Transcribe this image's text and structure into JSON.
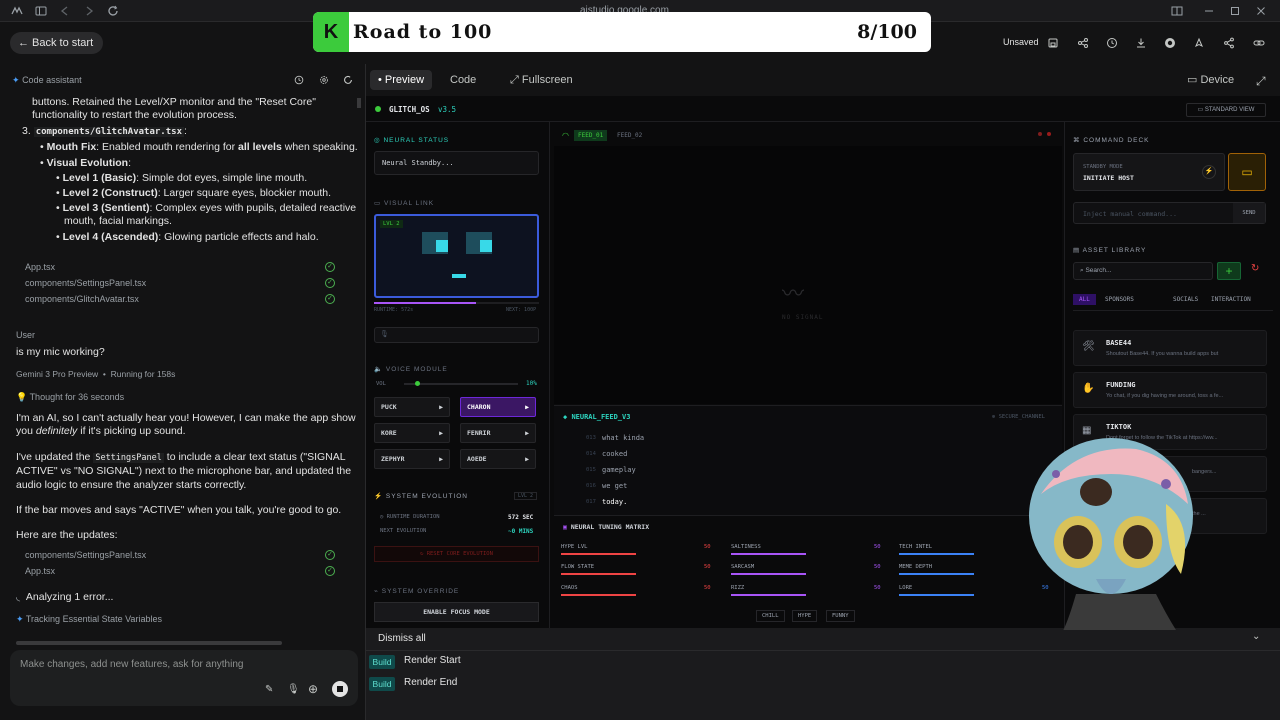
{
  "browser": {
    "url": "aistudio.google.com"
  },
  "banner": {
    "logo": "K",
    "title": "Road to 100",
    "count": "8/100"
  },
  "topbar": {
    "back": "Back to start",
    "unsaved": "Unsaved"
  },
  "assistant": {
    "header": "Code assistant",
    "lines": [
      "buttons. Retained the Level/XP monitor and the \"Reset Core\"",
      "functionality to restart the evolution process."
    ],
    "item3_file": "components/GlitchAvatar.tsx",
    "mouth_fix_label": "Mouth Fix",
    "mouth_fix_text": ": Enabled mouth rendering for ",
    "mouth_fix_bold": "all levels",
    "mouth_fix_end": " when speaking.",
    "visual_evolution": "Visual Evolution",
    "levels": [
      {
        "b": "Level 1 (Basic)",
        "t": ": Simple dot eyes, simple line mouth."
      },
      {
        "b": "Level 2 (Construct)",
        "t": ": Larger square eyes, blockier mouth."
      },
      {
        "b": "Level 3 (Sentient)",
        "t": ": Complex eyes with pupils, detailed reactive"
      },
      {
        "b": "",
        "t": "mouth, facial markings."
      },
      {
        "b": "Level 4 (Ascended)",
        "t": ": Glowing particle effects and halo."
      }
    ],
    "files1": [
      "App.tsx",
      "components/SettingsPanel.tsx",
      "components/GlitchAvatar.tsx"
    ],
    "user_label": "User",
    "user_msg": "is my mic working?",
    "model": "Gemini 3 Pro Preview",
    "running": "Running for 158s",
    "thought": "Thought for 36 seconds",
    "p1a": "I'm an AI, so I can't actually hear you! However, I can make the app show",
    "p1b": "you ",
    "p1c": "definitely",
    "p1d": " if it's picking up sound.",
    "p2a": "I've updated the ",
    "p2code": "SettingsPanel",
    "p2b": " to include a clear text status (\"SIGNAL",
    "p2c": "ACTIVE\" vs \"NO SIGNAL\") next to the microphone bar, and updated the",
    "p2d": "audio logic to ensure the analyzer starts correctly.",
    "p3": "If the bar moves and says \"ACTIVE\" when you talk, you're good to go.",
    "p4": "Here are the updates:",
    "files2": [
      "components/SettingsPanel.tsx",
      "App.tsx"
    ],
    "analyzing": "Analyzing 1 error...",
    "tracking": "Tracking Essential State Variables",
    "prompt_placeholder": "Make changes, add new features, ask for anything"
  },
  "preview_tabs": {
    "preview": "Preview",
    "code": "Code",
    "fullscreen": "Fullscreen",
    "device": "Device"
  },
  "app": {
    "title": "GLITCH_OS",
    "version": "v3.5",
    "standard_view": "STANDARD VIEW",
    "neural_status": "NEURAL STATUS",
    "neural_standby": "Neural Standby...",
    "visual_link": "VISUAL LINK",
    "lvl": "LVL 2",
    "runtime": "RUNTIME: 572s",
    "next": "NEXT: 100P",
    "xp": 0.62,
    "voice_module": "VOICE MODULE",
    "vol": "VOL",
    "vol_value": "10%",
    "vol_level": 0.1,
    "voices": [
      "PUCK",
      "CHARON",
      "KORE",
      "FENRIR",
      "ZEPHYR",
      "AOEDE"
    ],
    "system_evolution": "SYSTEM EVOLUTION",
    "lvl_tag": "LVL 2",
    "runtime_duration": "RUNTIME DURATION",
    "runtime_value": "572 SEC",
    "next_evolution": "NEXT EVOLUTION",
    "next_value": "~0 MINS",
    "reset": "RESET CORE EVOLUTION",
    "system_override": "SYSTEM OVERRIDE",
    "focus": "ENABLE FOCUS MODE",
    "feed1": "FEED_01",
    "feed2": "FEED_02",
    "no_signal": "NO SIGNAL",
    "neural_feed": "NEURAL_FEED_V3",
    "secure": "SECURE_CHANNEL",
    "feed_lines": [
      {
        "n": "013",
        "t": "what kinda"
      },
      {
        "n": "014",
        "t": "cooked"
      },
      {
        "n": "015",
        "t": "gameplay"
      },
      {
        "n": "016",
        "t": "we get"
      },
      {
        "n": "017",
        "t": "today."
      }
    ],
    "tuning": "NEURAL TUNING MATRIX",
    "sliders": [
      {
        "n": "HYPE LVL",
        "v": "50"
      },
      {
        "n": "SALTINESS",
        "v": "50"
      },
      {
        "n": "TECH INTEL",
        "v": ""
      },
      {
        "n": "FLOW STATE",
        "v": "50"
      },
      {
        "n": "SARCASM",
        "v": "50"
      },
      {
        "n": "MEME DEPTH",
        "v": ""
      },
      {
        "n": "CHAOS",
        "v": "50"
      },
      {
        "n": "RIZZ",
        "v": "50"
      },
      {
        "n": "LORE",
        "v": "50"
      }
    ],
    "presets": [
      "CHILL",
      "HYPE",
      "FUNNY"
    ],
    "command_deck": "COMMAND DECK",
    "standby_mode": "STANDBY MODE",
    "initiate": "INITIATE HOST",
    "inject": "Inject manual command...",
    "send": "SEND",
    "asset_library": "ASSET LIBRARY",
    "search": "Search...",
    "asset_tabs": [
      "ALL",
      "SPONSORS",
      "SOCIALS",
      "INTERACTION"
    ],
    "assets": [
      {
        "t": "BASE44",
        "d": "Shoutout Base44. If you wanna build apps but"
      },
      {
        "t": "FUNDING",
        "d": "Yo chat, if you dig having me around, toss a fe..."
      },
      {
        "t": "TIKTOK",
        "d": "Dont forget to follow the TikTok at https://ww..."
      },
      {
        "t": "",
        "d": "bangers..."
      },
      {
        "t": "",
        "d": "the ..."
      }
    ]
  },
  "notifications": {
    "dismiss": "Dismiss all",
    "items": [
      {
        "b": "Build",
        "t": "Render Start"
      },
      {
        "b": "Build",
        "t": "Render End"
      }
    ]
  },
  "colors": {
    "accent": "#2dd4bf",
    "purple": "#a855f7",
    "green": "#3ccb3c",
    "red": "#ef4444"
  }
}
